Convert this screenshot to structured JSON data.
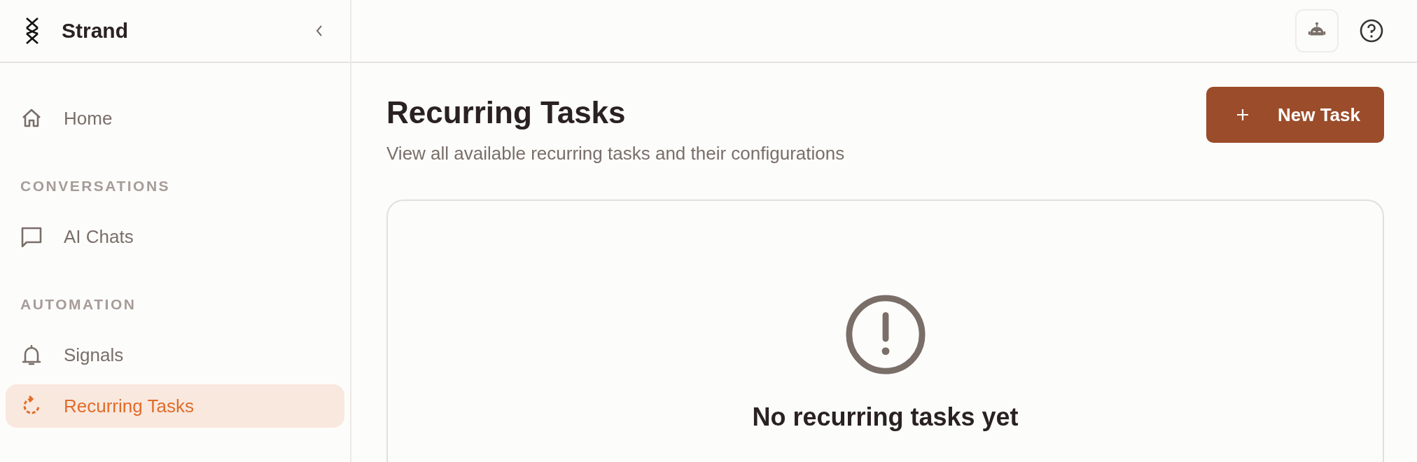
{
  "sidebar": {
    "brand": "Strand",
    "sections": [
      {
        "items": [
          {
            "label": "Home",
            "selected": false
          }
        ]
      },
      {
        "heading": "CONVERSATIONS",
        "items": [
          {
            "label": "AI Chats",
            "selected": false
          }
        ]
      },
      {
        "heading": "AUTOMATION",
        "items": [
          {
            "label": "Signals",
            "selected": false
          },
          {
            "label": "Recurring Tasks",
            "selected": true
          }
        ]
      }
    ]
  },
  "page": {
    "title": "Recurring Tasks",
    "subtitle": "View all available recurring tasks and their configurations",
    "new_button": "New Task"
  },
  "empty_state": {
    "title": "No recurring tasks yet"
  }
}
